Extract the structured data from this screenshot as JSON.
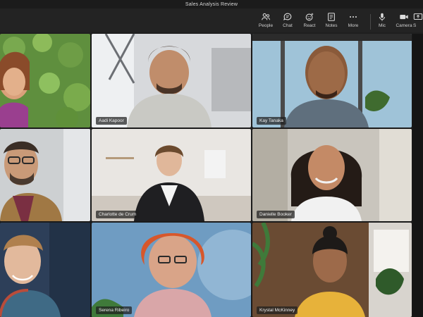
{
  "window": {
    "title": "Sales Analysis Review"
  },
  "toolbar": {
    "items": [
      {
        "label": "People",
        "icon": "people-icon"
      },
      {
        "label": "Chat",
        "icon": "chat-icon"
      },
      {
        "label": "React",
        "icon": "react-icon"
      },
      {
        "label": "Notes",
        "icon": "notes-icon"
      },
      {
        "label": "More",
        "icon": "more-icon"
      },
      {
        "label": "Mic",
        "icon": "mic-icon"
      },
      {
        "label": "Camera",
        "icon": "camera-icon"
      },
      {
        "label": "S",
        "icon": "share-icon"
      }
    ]
  },
  "participants": [
    {
      "name": "",
      "kind": "avatar"
    },
    {
      "name": "Aadi Kapoor",
      "kind": "video"
    },
    {
      "name": "Kay Tanaka",
      "kind": "avatar"
    },
    {
      "name": "",
      "kind": "video"
    },
    {
      "name": "Charlotte de Crum",
      "kind": "video"
    },
    {
      "name": "Danielle Booker",
      "kind": "video"
    },
    {
      "name": "",
      "kind": "video"
    },
    {
      "name": "Serena Ribeiro",
      "kind": "avatar"
    },
    {
      "name": "Krystal McKinney",
      "kind": "avatar"
    }
  ],
  "colors": {
    "toolbar_bg": "#232323",
    "grid_bg": "#1a1a1a",
    "name_tag_bg": "#1e1e1e"
  }
}
